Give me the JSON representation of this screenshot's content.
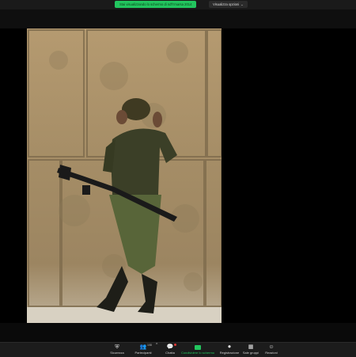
{
  "top_bar": {
    "share_banner_text": "Stai visualizzando lo schermo di nd'h'marsa 2014",
    "view_options_label": "Visualizza opzioni"
  },
  "toolbar": {
    "items": [
      {
        "label": "Sicurezza",
        "icon": "shield-icon"
      },
      {
        "label": "Partecipanti",
        "icon": "participants-icon",
        "count": "108"
      },
      {
        "label": "Chatta",
        "icon": "chat-icon"
      },
      {
        "label": "Condividere lo schermo",
        "icon": "share-screen-icon"
      },
      {
        "label": "Registrazione",
        "icon": "record-icon"
      },
      {
        "label": "Sale gruppi",
        "icon": "breakout-rooms-icon"
      },
      {
        "label": "Reazioni",
        "icon": "reactions-icon"
      }
    ]
  },
  "colors": {
    "share_green": "#22c55e",
    "toolbar_bg": "#1c1c1c",
    "notification_red": "#e53935"
  }
}
